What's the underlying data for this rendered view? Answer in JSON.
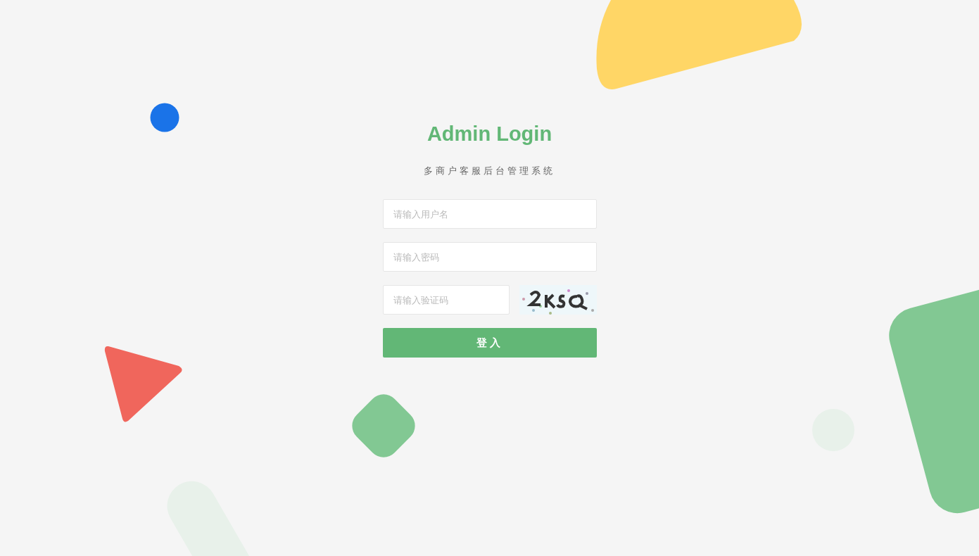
{
  "login": {
    "title": "Admin Login",
    "subtitle": "多商户客服后台管理系统",
    "fields": [
      {
        "kind": "text",
        "placeholder": "请输入用户名"
      },
      {
        "kind": "password",
        "placeholder": "请输入密码"
      },
      {
        "kind": "captcha",
        "placeholder": "请输入验证码"
      }
    ],
    "submit": {
      "label": "登入"
    }
  }
}
